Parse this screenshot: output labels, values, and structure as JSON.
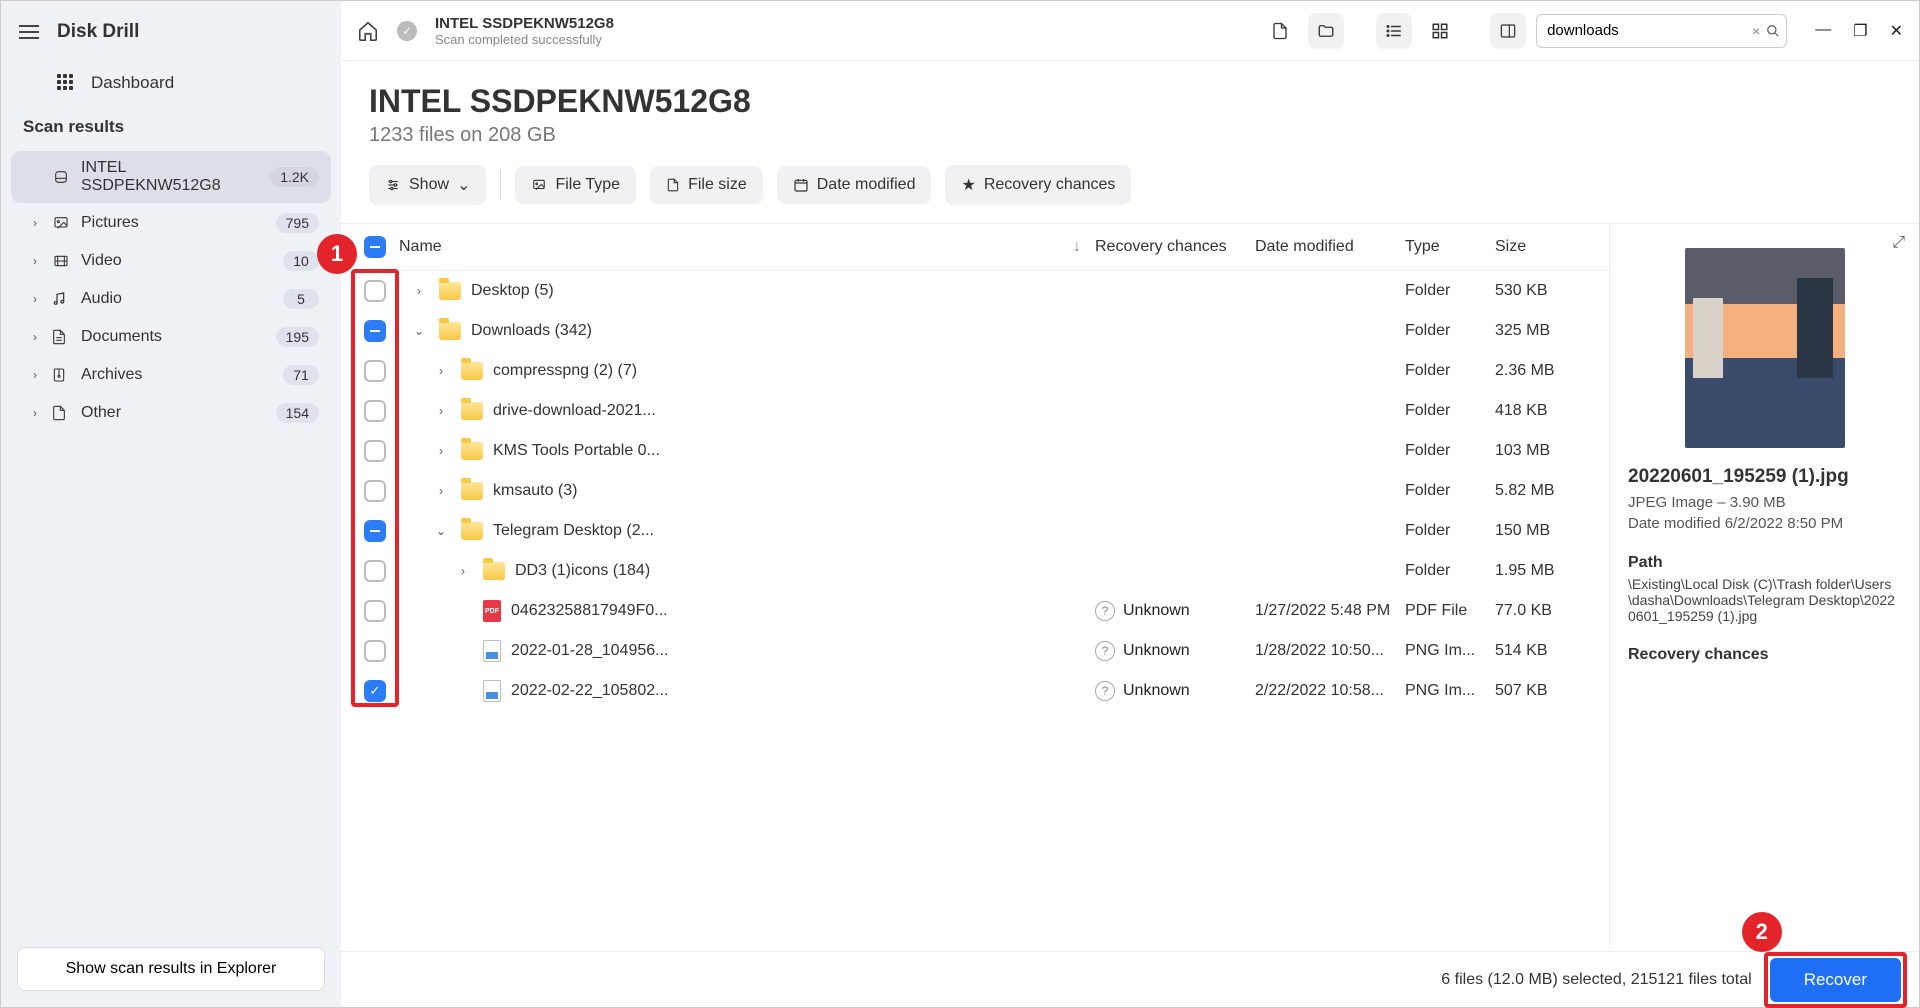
{
  "app_name": "Disk Drill",
  "dashboard_label": "Dashboard",
  "scan_results_label": "Scan results",
  "sidebar_items": [
    {
      "label": "INTEL SSDPEKNW512G8",
      "badge": "1.2K",
      "chev": "",
      "icon": "disk"
    },
    {
      "label": "Pictures",
      "badge": "795",
      "chev": "›",
      "icon": "img"
    },
    {
      "label": "Video",
      "badge": "10",
      "chev": "›",
      "icon": "vid"
    },
    {
      "label": "Audio",
      "badge": "5",
      "chev": "›",
      "icon": "aud"
    },
    {
      "label": "Documents",
      "badge": "195",
      "chev": "›",
      "icon": "doc"
    },
    {
      "label": "Archives",
      "badge": "71",
      "chev": "›",
      "icon": "arc"
    },
    {
      "label": "Other",
      "badge": "154",
      "chev": "›",
      "icon": "oth"
    }
  ],
  "show_in_explorer": "Show scan results in Explorer",
  "top": {
    "title": "INTEL SSDPEKNW512G8",
    "sub": "Scan completed successfully",
    "search_value": "downloads"
  },
  "header": {
    "big": "INTEL SSDPEKNW512G8",
    "sub": "1233 files on 208 GB"
  },
  "filters": {
    "show": "Show",
    "file_type": "File Type",
    "file_size": "File size",
    "date_modified": "Date modified",
    "recovery_chances": "Recovery chances"
  },
  "columns": {
    "name": "Name",
    "recovery": "Recovery chances",
    "date": "Date modified",
    "type": "Type",
    "size": "Size"
  },
  "rows": [
    {
      "indent": 0,
      "check": "empty",
      "exp": "›",
      "kind": "folder",
      "name": "Desktop (5)",
      "rec": "",
      "date": "",
      "type": "Folder",
      "size": "530 KB"
    },
    {
      "indent": 0,
      "check": "partial",
      "exp": "⌄",
      "kind": "folder",
      "name": "Downloads (342)",
      "rec": "",
      "date": "",
      "type": "Folder",
      "size": "325 MB"
    },
    {
      "indent": 1,
      "check": "empty",
      "exp": "›",
      "kind": "folder",
      "name": "compresspng (2) (7)",
      "rec": "",
      "date": "",
      "type": "Folder",
      "size": "2.36 MB"
    },
    {
      "indent": 1,
      "check": "empty",
      "exp": "›",
      "kind": "folder",
      "name": "drive-download-2021...",
      "rec": "",
      "date": "",
      "type": "Folder",
      "size": "418 KB"
    },
    {
      "indent": 1,
      "check": "empty",
      "exp": "›",
      "kind": "folder",
      "name": "KMS Tools Portable 0...",
      "rec": "",
      "date": "",
      "type": "Folder",
      "size": "103 MB"
    },
    {
      "indent": 1,
      "check": "empty",
      "exp": "›",
      "kind": "folder",
      "name": "kmsauto (3)",
      "rec": "",
      "date": "",
      "type": "Folder",
      "size": "5.82 MB"
    },
    {
      "indent": 1,
      "check": "partial",
      "exp": "⌄",
      "kind": "folder",
      "name": "Telegram Desktop (2...",
      "rec": "",
      "date": "",
      "type": "Folder",
      "size": "150 MB"
    },
    {
      "indent": 2,
      "check": "empty",
      "exp": "›",
      "kind": "folder",
      "name": "DD3 (1)icons (184)",
      "rec": "",
      "date": "",
      "type": "Folder",
      "size": "1.95 MB"
    },
    {
      "indent": 2,
      "check": "empty",
      "exp": "",
      "kind": "pdf",
      "name": "04623258817949F0...",
      "rec": "Unknown",
      "date": "1/27/2022 5:48 PM",
      "type": "PDF File",
      "size": "77.0 KB"
    },
    {
      "indent": 2,
      "check": "empty",
      "exp": "",
      "kind": "png",
      "name": "2022-01-28_104956...",
      "rec": "Unknown",
      "date": "1/28/2022 10:50...",
      "type": "PNG Im...",
      "size": "514 KB"
    },
    {
      "indent": 2,
      "check": "checked",
      "exp": "",
      "kind": "png",
      "name": "2022-02-22_105802...",
      "rec": "Unknown",
      "date": "2/22/2022 10:58...",
      "type": "PNG Im...",
      "size": "507 KB"
    }
  ],
  "preview": {
    "title": "20220601_195259 (1).jpg",
    "meta1": "JPEG Image – 3.90 MB",
    "meta2": "Date modified 6/2/2022 8:50 PM",
    "path_label": "Path",
    "path": "\\Existing\\Local Disk (C)\\Trash folder\\Users\\dasha\\Downloads\\Telegram Desktop\\20220601_195259 (1).jpg",
    "rec_label": "Recovery chances"
  },
  "footer": {
    "text": "6 files (12.0 MB) selected, 215121 files total",
    "recover": "Recover"
  },
  "annotations": {
    "one": "1",
    "two": "2"
  }
}
